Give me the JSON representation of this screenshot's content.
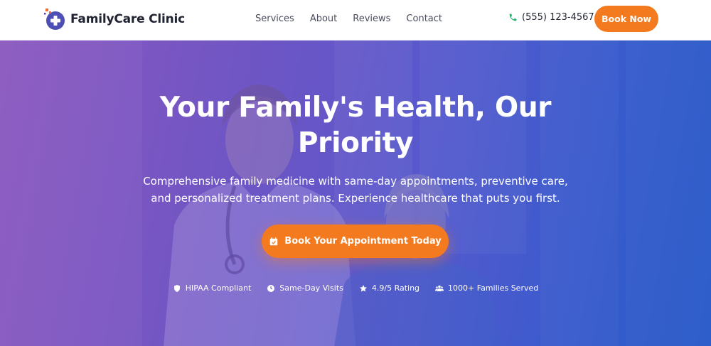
{
  "header": {
    "brand_name": "FamilyCare Clinic",
    "nav": [
      "Services",
      "About",
      "Reviews",
      "Contact"
    ],
    "phone": "(555) 123-4567",
    "book_now": "Book Now"
  },
  "hero": {
    "headline_line1": "Your Family's Health, Our",
    "headline_line2": "Priority",
    "subtext_line1": "Comprehensive family medicine with same-day appointments, preventive care,",
    "subtext_line2": "and personalized treatment plans. Experience healthcare that puts you first.",
    "cta_label": "Book Your Appointment Today",
    "badges": [
      {
        "icon": "shield-icon",
        "label": "HIPAA Compliant"
      },
      {
        "icon": "clock-icon",
        "label": "Same-Day Visits"
      },
      {
        "icon": "star-icon",
        "label": "4.9/5 Rating"
      },
      {
        "icon": "users-icon",
        "label": "1000+ Families Served"
      }
    ]
  },
  "colors": {
    "accent": "#f47a1f",
    "brand_purple": "#5b54c4",
    "phone_icon": "#1db46a",
    "text_dark": "#1f2230"
  }
}
